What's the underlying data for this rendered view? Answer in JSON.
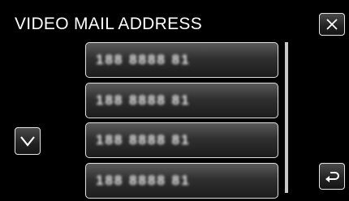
{
  "header": {
    "title": "VIDEO MAIL ADDRESS"
  },
  "icons": {
    "close": "close-icon",
    "scroll_down": "chevron-down-icon",
    "back": "return-arrow-icon"
  },
  "list": {
    "items": [
      {
        "address": "188 8888 81"
      },
      {
        "address": "188 8888 81"
      },
      {
        "address": "188 8888 81"
      },
      {
        "address": "188 8888 81"
      }
    ]
  },
  "colors": {
    "background": "#000000",
    "text": "#ffffff",
    "border": "#e0e0e0"
  }
}
